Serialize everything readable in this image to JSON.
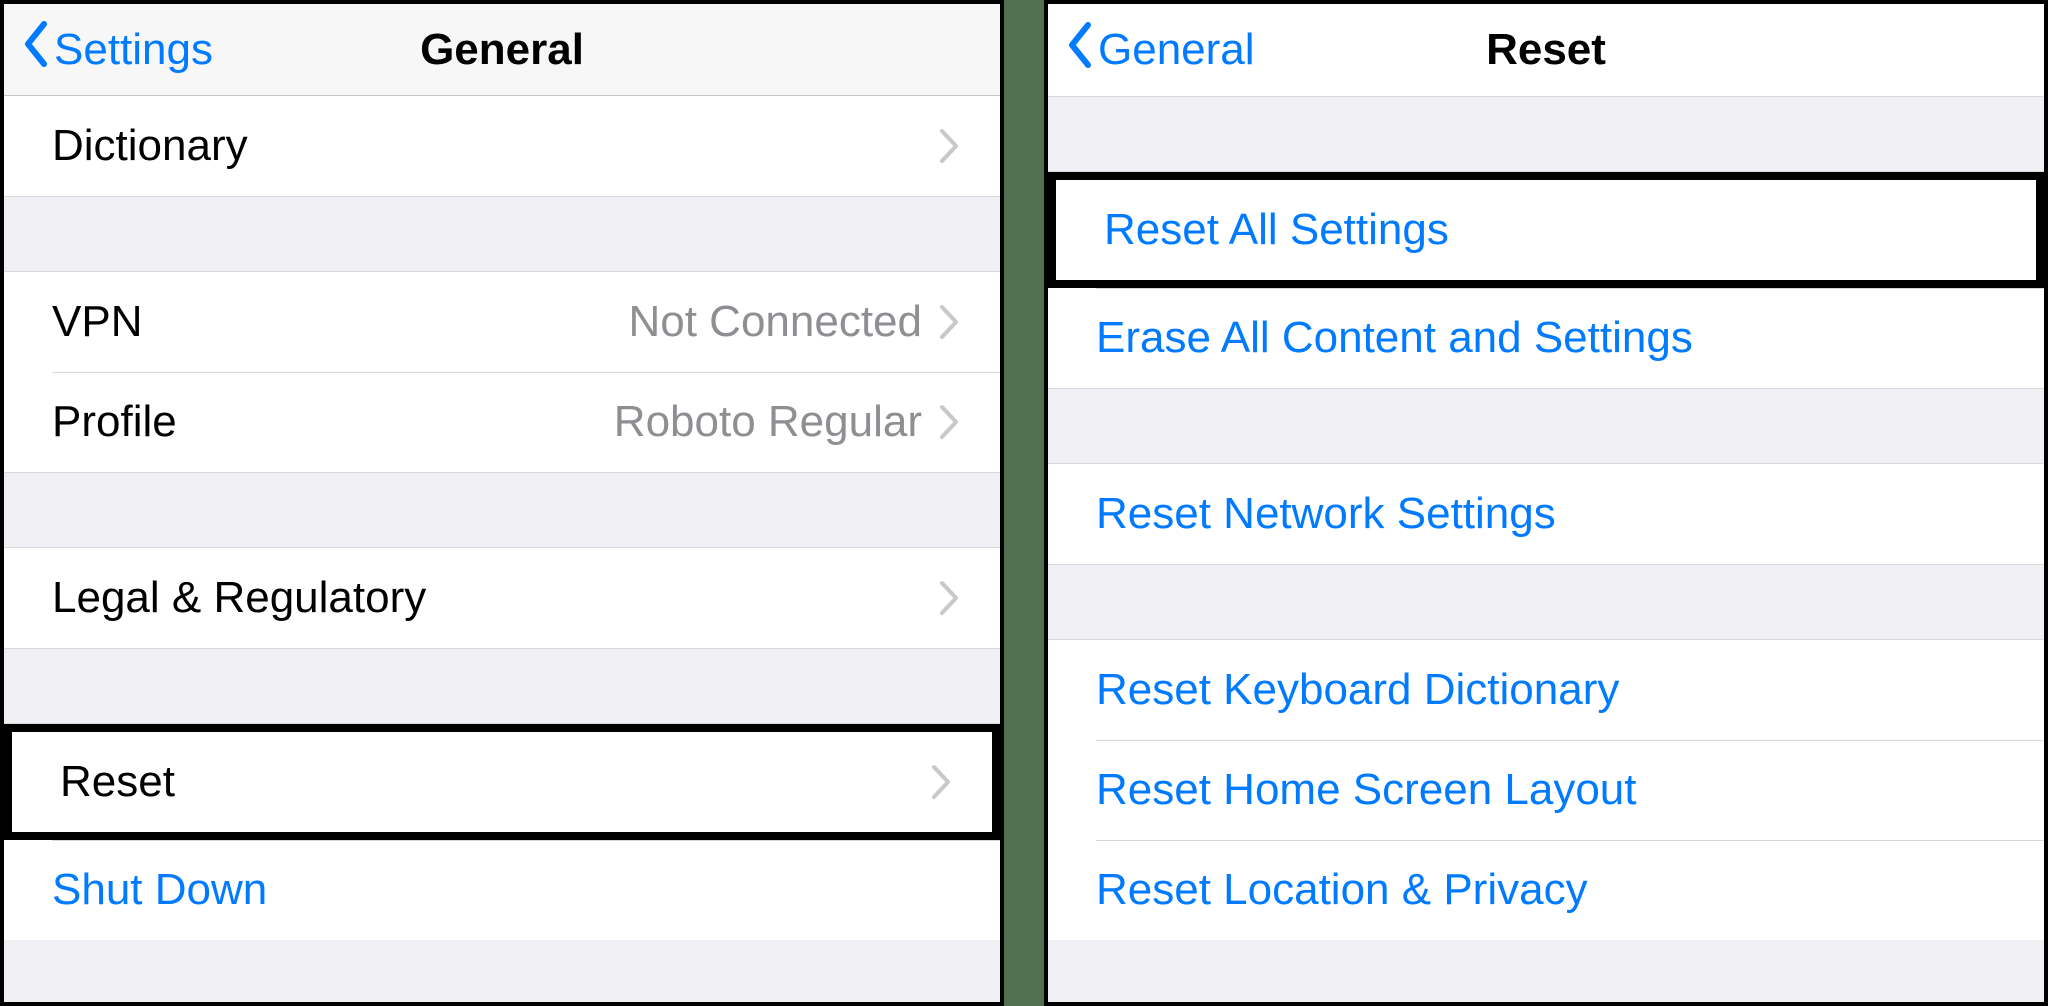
{
  "left": {
    "back": "Settings",
    "title": "General",
    "rows": {
      "dictionary": "Dictionary",
      "vpn": {
        "label": "VPN",
        "value": "Not Connected"
      },
      "profile": {
        "label": "Profile",
        "value": "Roboto Regular"
      },
      "legal": "Legal & Regulatory",
      "reset": "Reset",
      "shutdown": "Shut Down"
    }
  },
  "right": {
    "back": "General",
    "title": "Reset",
    "rows": {
      "reset_all": "Reset All Settings",
      "erase_all": "Erase All Content and Settings",
      "reset_network": "Reset Network Settings",
      "reset_keyboard": "Reset Keyboard Dictionary",
      "reset_home": "Reset Home Screen Layout",
      "reset_location": "Reset Location & Privacy"
    }
  }
}
